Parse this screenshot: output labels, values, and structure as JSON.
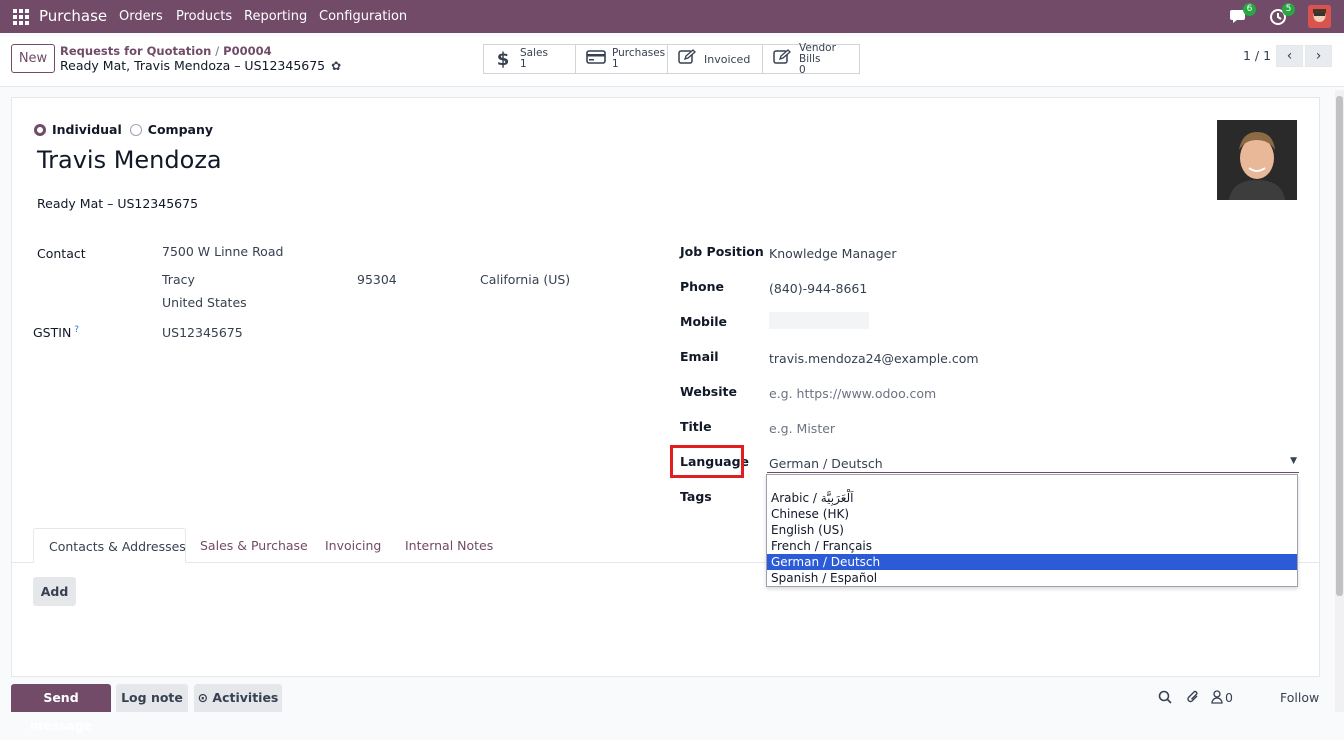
{
  "topbar": {
    "brand": "Purchase",
    "menu": [
      "Orders",
      "Products",
      "Reporting",
      "Configuration"
    ],
    "chat_badge": "6",
    "activity_badge": "5"
  },
  "control": {
    "new_label": "New",
    "breadcrumb_parent": "Requests for Quotation",
    "breadcrumb_sep": "/",
    "breadcrumb_record": "P00004",
    "record_title": "Ready Mat, Travis Mendoza – US12345675",
    "smart_buttons": [
      {
        "label": "Sales",
        "count": "1",
        "icon": "dollar-icon"
      },
      {
        "label": "Purchases",
        "count": "1",
        "icon": "credit-card-icon"
      },
      {
        "label": "Invoiced",
        "count": "",
        "icon": "edit-icon"
      },
      {
        "label": "Vendor Bills",
        "count": "0",
        "icon": "edit-icon"
      }
    ],
    "pager": "1 / 1"
  },
  "form": {
    "type_individual": "Individual",
    "type_company": "Company",
    "name": "Travis Mendoza",
    "company": "Ready Mat – US12345675",
    "contact_label": "Contact",
    "street": "7500 W Linne Road",
    "city": "Tracy",
    "zip": "95304",
    "state": "California (US)",
    "country": "United States",
    "gstin_label": "GSTIN",
    "gstin_help": "?",
    "gstin_value": "US12345675",
    "job_position_label": "Job Position",
    "job_position": "Knowledge Manager",
    "phone_label": "Phone",
    "phone": "(840)-944-8661",
    "mobile_label": "Mobile",
    "email_label": "Email",
    "email": "travis.mendoza24@example.com",
    "website_label": "Website",
    "website_placeholder": "e.g. https://www.odoo.com",
    "title_label": "Title",
    "title_placeholder": "e.g. Mister",
    "language_label": "Language",
    "language_value": "German / Deutsch",
    "tags_label": "Tags"
  },
  "language_options": [
    "Arabic / اَلْعَرَبِيَّة",
    "Chinese (HK)",
    "English (US)",
    "French / Français",
    "German / Deutsch",
    "Spanish / Español"
  ],
  "selected_language_index": 4,
  "tabs": [
    "Contacts & Addresses",
    "Sales & Purchase",
    "Invoicing",
    "Internal Notes"
  ],
  "add_label": "Add",
  "chatter": {
    "send_message": "Send message",
    "log_note": "Log note",
    "activities": "Activities",
    "followers_count": "0",
    "follow": "Follow"
  }
}
